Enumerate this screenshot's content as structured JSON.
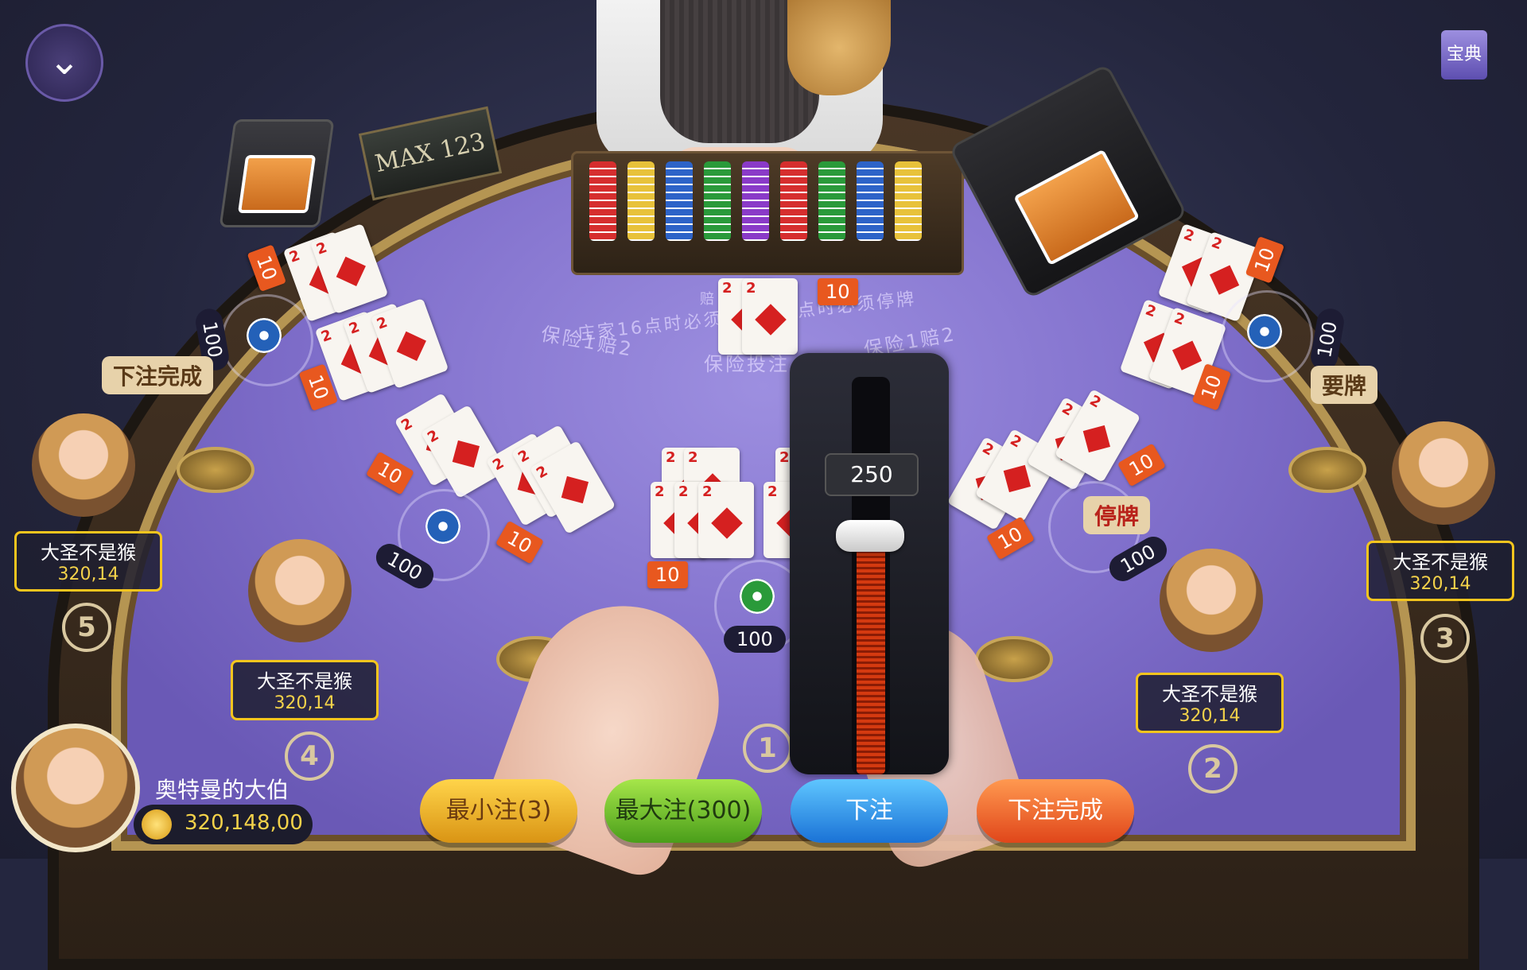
{
  "table": {
    "max_sign": "MAX  123",
    "rule_text": "庄家16点时必须要牌  17点时必须停牌",
    "payout_label": "赔",
    "insurance_left": "保险1赔2",
    "insurance_right": "保险1赔2",
    "insurance_bet": "保险投注"
  },
  "dealer": {
    "hand_value": "10",
    "cards": [
      "2",
      "2"
    ]
  },
  "spots": [
    {
      "seat": "5",
      "bet": "100",
      "hand_top": "10",
      "hand_bottom": "10"
    },
    {
      "seat": "4",
      "bet": "100",
      "hand_top": "10",
      "hand_bottom": "10"
    },
    {
      "seat": "1",
      "bet": "100",
      "hand_top": "10",
      "hand_bottom": "10"
    },
    {
      "seat": "2",
      "bet": "100",
      "hand_top": "10",
      "hand_bottom": "10"
    },
    {
      "seat": "3",
      "bet": "100",
      "hand_top": "10",
      "hand_bottom": "10"
    }
  ],
  "players": [
    {
      "name": "大圣不是猴",
      "score": "320,14",
      "seat": "5",
      "bubble": "下注完成"
    },
    {
      "name": "大圣不是猴",
      "score": "320,14",
      "seat": "4",
      "bubble": ""
    },
    {
      "name": "大圣不是猴",
      "score": "320,14",
      "seat": "2",
      "bubble": "停牌"
    },
    {
      "name": "大圣不是猴",
      "score": "320,14",
      "seat": "3",
      "bubble": "要牌"
    }
  ],
  "me": {
    "name": "奥特曼的大伯",
    "coins": "320,148,00",
    "seat": "1"
  },
  "card_rank": "2",
  "slider": {
    "value": "250",
    "fraction": 0.6
  },
  "buttons": {
    "min_bet": "最小注(3)",
    "max_bet": "最大注(300)",
    "bet": "下注",
    "done": "下注完成"
  },
  "top": {
    "menu_icon": "chevron-down-icon",
    "guide_label": "宝典"
  }
}
